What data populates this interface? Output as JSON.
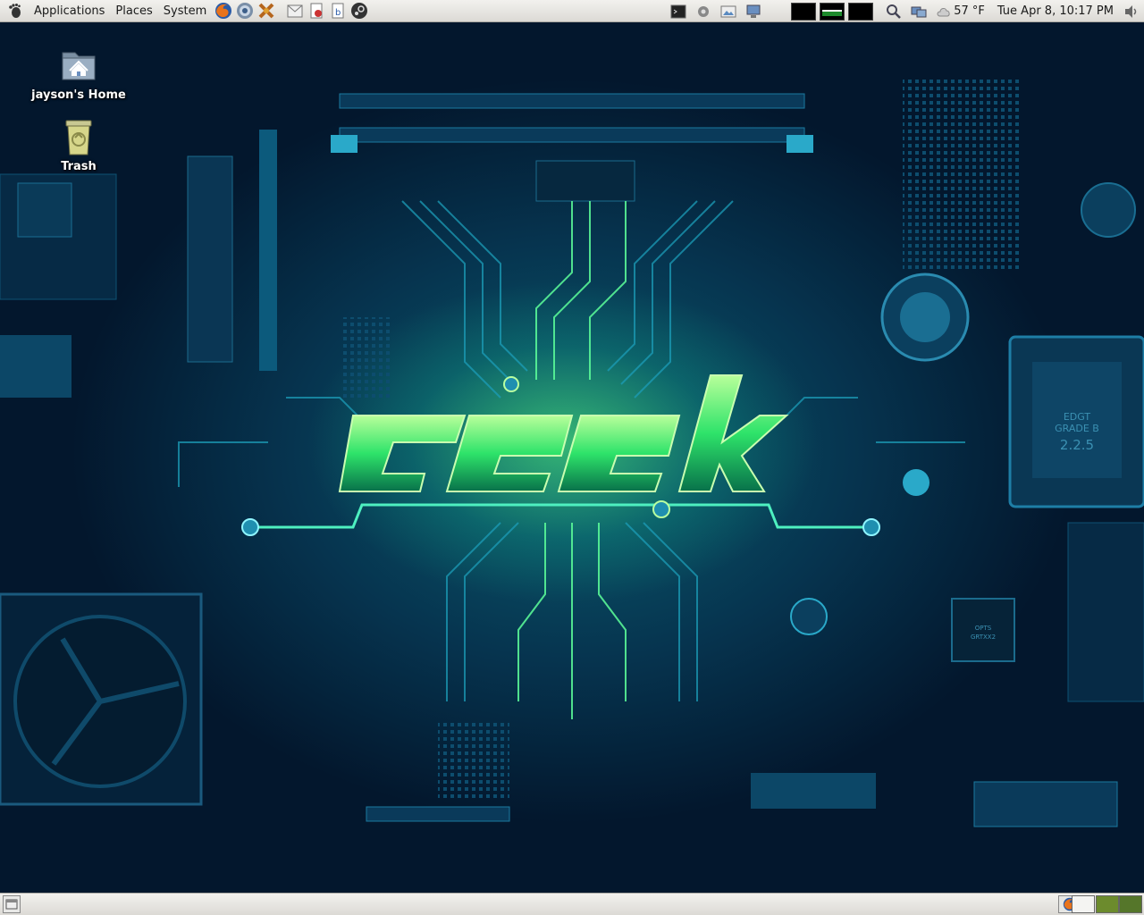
{
  "top_panel": {
    "menus": [
      "Applications",
      "Places",
      "System"
    ],
    "launchers": [
      "firefox-icon",
      "thunderbird-icon",
      "games-icon",
      "mail-icon",
      "document-icon",
      "office-icon",
      "steam-icon"
    ],
    "tray_icons": [
      "terminal-icon",
      "settings-icon",
      "image-viewer-icon",
      "network-icon"
    ],
    "weather": "57 °F",
    "clock": "Tue Apr  8, 10:17 PM"
  },
  "desktop": {
    "icons": [
      {
        "label": "jayson's Home",
        "icon": "home-folder-icon"
      },
      {
        "label": "Trash",
        "icon": "trash-icon"
      }
    ],
    "wallpaper_text": "geek",
    "board_labels": [
      "EDGT GRADE B 2.2.5",
      "OPTS GRTXX2"
    ]
  },
  "colors": {
    "panel": "#dcdad5",
    "wallpaper_dark": "#041428",
    "wallpaper_mid": "#0b5e70",
    "glow": "#5aff78"
  }
}
